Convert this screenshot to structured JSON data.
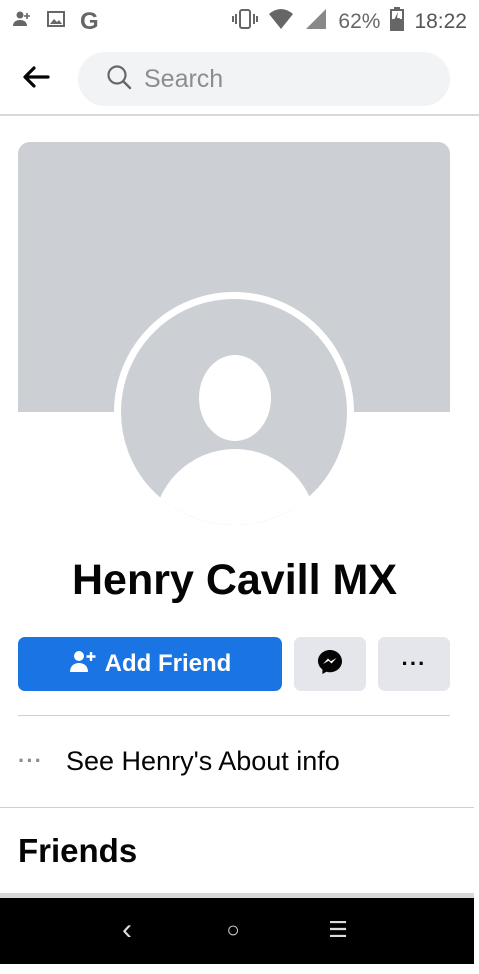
{
  "status": {
    "battery_percent": "62%",
    "time": "18:22",
    "google_glyph": "G"
  },
  "topbar": {
    "search_placeholder": "Search"
  },
  "profile": {
    "name": "Henry Cavill MX"
  },
  "actions": {
    "add_friend_label": "Add Friend",
    "more_label": "···"
  },
  "about": {
    "dots": "···",
    "label": "See Henry's About info"
  },
  "sections": {
    "friends_title": "Friends"
  },
  "nav": {
    "back": "‹",
    "home": "○",
    "recents": "☰"
  },
  "colors": {
    "accent": "#1b74e4",
    "cover": "#ccd0d5",
    "button_gray": "#e4e6eb"
  }
}
